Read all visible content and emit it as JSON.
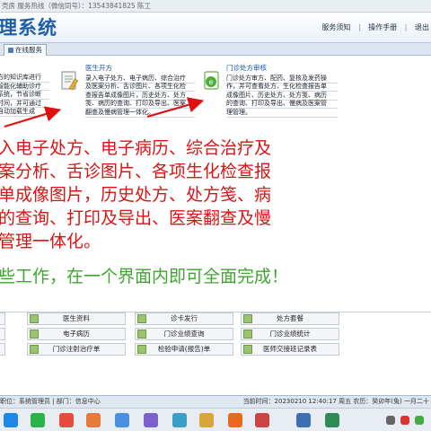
{
  "topbar": {
    "text": "壳房   服务热线（微信同号）：13543841825  陈工"
  },
  "banner": {
    "title": "理系统",
    "links": [
      "服务须知",
      "操作手册",
      "|",
      "退出"
    ]
  },
  "tabs": [
    {
      "label": "在线服务"
    }
  ],
  "cards": [
    {
      "lines": [
        "方的知识库进行",
        "智能化辅助诊疗",
        "系统，节省诊断",
        "时间，并可通过",
        "自动加载生成"
      ]
    },
    {
      "title": "医生开方",
      "desc": [
        "录入电子处方、电子病历、综合治疗",
        "及医案分析、舌诊图片、各项生化检",
        "查报告单成像图片，历史处方、处方",
        "笺、病历的查询、打印及导出、医案",
        "翻查及慢病管理一体化。"
      ]
    },
    {
      "title": "门诊处方审核",
      "desc": [
        "门诊处方审方、配药、复核及发药操",
        "作，并可查看处方、生化检查报告单",
        "成像图片、历史处方、处方笺、病历",
        "的查询、打印及导出、慢病及医案管",
        "理管理。"
      ]
    }
  ],
  "big_lines": [
    "入电子处方、电子病历、综合治疗及",
    "案分析、舌诊图片、各项生化检查报",
    "单成像图片，历史处方、处方笺、病",
    "的查询、打印及导出、医案翻查及慢",
    "管理一体化。"
  ],
  "green_line": "些工作，在一个界面内即可全面完成！",
  "grid_buttons": [
    "医生资料",
    "诊卡发行",
    "处方套餐",
    "电子病历",
    "门诊业绩查询",
    "门诊业绩统计",
    "门诊注射治疗单",
    "检验申请(报告)单",
    "医师交接班记录表"
  ],
  "status": {
    "left": "职位：系统管理员  |  部门：信息中心",
    "right": "当前时间：20230210  12:40:17  周五  农历：癸卯年(兔) 一月二十"
  },
  "colors": {
    "accent": "#1d5fa8",
    "red_text": "#d81515",
    "green_text": "#3fa62f",
    "arrow": "#e01010"
  },
  "icons": {
    "doctor_card": "prescription-pad-icon",
    "review_card": "green-document-icon",
    "grid": "green-card-icon"
  }
}
